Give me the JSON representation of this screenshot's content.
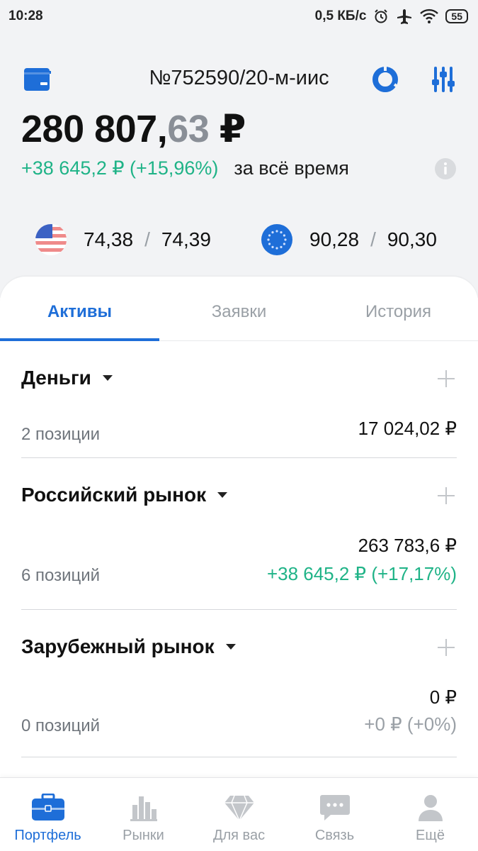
{
  "status_bar": {
    "time": "10:28",
    "speed": "0,5 КБ/с",
    "battery": "55"
  },
  "header": {
    "account": "№752590/20-м-иис",
    "balance_int": "280 807,",
    "balance_frac": "63",
    "balance_currency": " ₽",
    "gain": "+38 645,2 ₽ (+15,96%)",
    "gain_period": "за всё время"
  },
  "currencies": {
    "usd": {
      "buy": "74,38",
      "sep": "/",
      "sell": "74,39"
    },
    "eur": {
      "buy": "90,28",
      "sep": "/",
      "sell": "90,30"
    }
  },
  "tabs": [
    {
      "label": "Активы",
      "active": true
    },
    {
      "label": "Заявки",
      "active": false
    },
    {
      "label": "История",
      "active": false
    }
  ],
  "sections": [
    {
      "title": "Деньги",
      "positions": "2 позиции",
      "amount": "17 024,02 ₽",
      "change": ""
    },
    {
      "title": "Российский рынок",
      "positions": "6 позиций",
      "amount": "263 783,6 ₽",
      "change": "+38 645,2 ₽ (+17,17%)"
    },
    {
      "title": "Зарубежный рынок",
      "positions": "0 позиций",
      "amount": "0 ₽",
      "change": "+0 ₽ (+0%)"
    }
  ],
  "nav": [
    {
      "label": "Портфель",
      "icon": "briefcase-icon",
      "active": true
    },
    {
      "label": "Рынки",
      "icon": "bar-chart-icon",
      "active": false
    },
    {
      "label": "Для вас",
      "icon": "diamond-icon",
      "active": false
    },
    {
      "label": "Связь",
      "icon": "chat-icon",
      "active": false
    },
    {
      "label": "Ещё",
      "icon": "profile-icon",
      "active": false
    }
  ],
  "colors": {
    "accent": "#1e6ed8",
    "positive": "#1fb387",
    "muted": "#9aa0a6"
  }
}
